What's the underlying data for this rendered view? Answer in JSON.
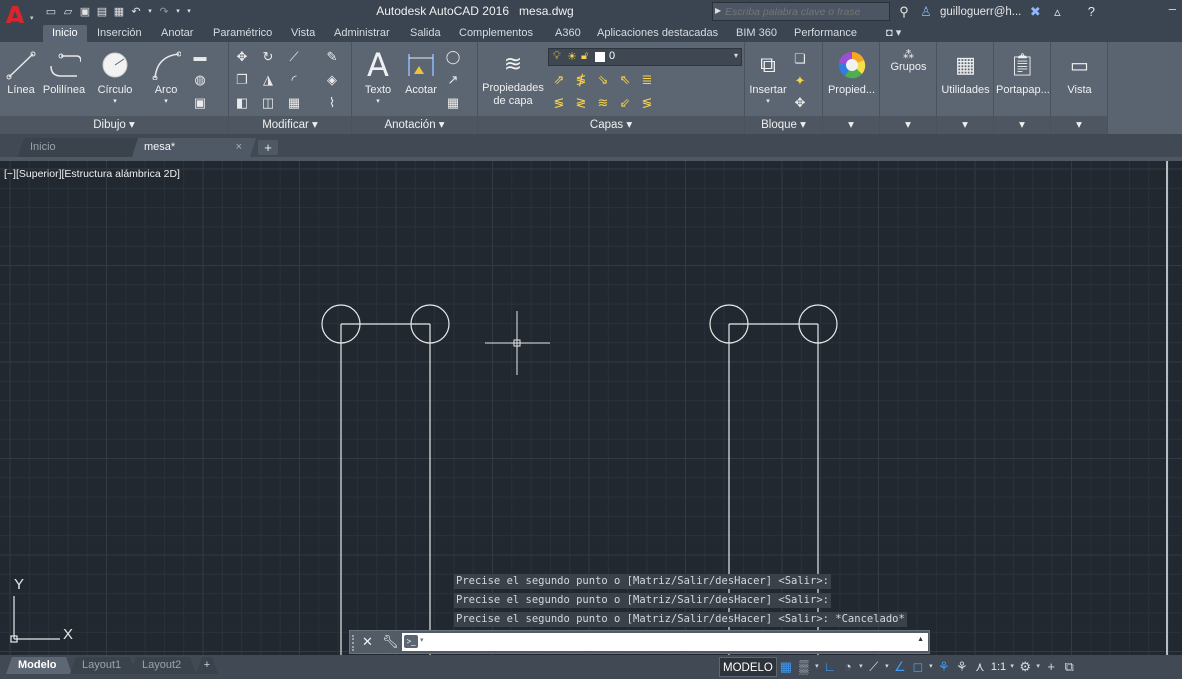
{
  "title_bar": {
    "app_name": "Autodesk AutoCAD 2016",
    "file_name": "mesa.dwg",
    "search_placeholder": "Escriba palabra clave o frase",
    "user": "guilloguerr@h..."
  },
  "ribbon_tabs": [
    "Inicio",
    "Inserción",
    "Anotar",
    "Paramétrico",
    "Vista",
    "Administrar",
    "Salida",
    "Complementos",
    "A360",
    "Aplicaciones destacadas",
    "BIM 360",
    "Performance"
  ],
  "panels": {
    "dibujo": {
      "title": "Dibujo",
      "linea": "Línea",
      "polilinea": "Polilínea",
      "circulo": "Círculo",
      "arco": "Arco"
    },
    "modificar": {
      "title": "Modificar"
    },
    "anotacion": {
      "title": "Anotación",
      "texto": "Texto",
      "acotar": "Acotar"
    },
    "capas": {
      "title": "Capas",
      "propiedades_1": "Propiedades",
      "propiedades_2": "de capa",
      "current_layer": "0"
    },
    "bloque": {
      "title": "Bloque",
      "insertar": "Insertar"
    },
    "propiedades": {
      "label": "Propied..."
    },
    "grupos": {
      "label": "Grupos"
    },
    "utilidades": {
      "label": "Utilidades"
    },
    "portapapeles": {
      "label": "Portapap..."
    },
    "vista": {
      "label": "Vista"
    }
  },
  "file_tabs": {
    "start": "Inicio",
    "active": "mesa*"
  },
  "viewport_label": "[−][Superior][Estructura alámbrica 2D]",
  "ucs": {
    "x": "X",
    "y": "Y"
  },
  "command_history": [
    "Precise el segundo punto o [Matriz/Salir/desHacer] <Salir>:",
    "Precise el segundo punto o [Matriz/Salir/desHacer] <Salir>:",
    "Precise el segundo punto o [Matriz/Salir/desHacer] <Salir>: *Cancelado*"
  ],
  "layout_tabs": [
    "Modelo",
    "Layout1",
    "Layout2"
  ],
  "status_bar": {
    "model_label": "MODELO",
    "scale": "1:1"
  },
  "colors": {
    "drawing_background": "#212830",
    "ribbon": "#5a6470",
    "accent_blue": "#3f9bf5",
    "logo_red": "#d8262c"
  }
}
